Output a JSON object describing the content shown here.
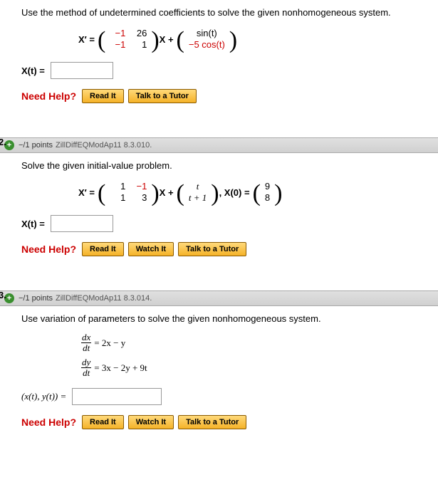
{
  "p1": {
    "prompt": "Use the method of undetermined coefficients to solve the given nonhomogeneous system.",
    "lhs": "X′ = ",
    "m": {
      "r1c1": "−1",
      "r1c2": "26",
      "r2c1": "−1",
      "r2c2": "1"
    },
    "mid": "X + ",
    "vec": {
      "top": "sin(t)",
      "bot": "−5 cos(t)"
    },
    "answer_label": "X(t) =",
    "help": "Need Help?",
    "read": "Read It",
    "tutor": "Talk to a Tutor"
  },
  "p2": {
    "qnum": "2.",
    "points": "−/1 points",
    "ref": "ZillDiffEQModAp11 8.3.010.",
    "prompt": "Solve the given initial-value problem.",
    "lhs": "X′ = ",
    "m": {
      "r1c1": "1",
      "r1c2": "−1",
      "r2c1": "1",
      "r2c2": "3"
    },
    "mid": "X + ",
    "vec": {
      "top": "t",
      "bot": "t + 1"
    },
    "comma": ",  X(0) = ",
    "ic": {
      "top": "9",
      "bot": "8"
    },
    "answer_label": "X(t) =",
    "help": "Need Help?",
    "read": "Read It",
    "watch": "Watch It",
    "tutor": "Talk to a Tutor"
  },
  "p3": {
    "qnum": "3.",
    "points": "−/1 points",
    "ref": "ZillDiffEQModAp11 8.3.014.",
    "prompt": "Use variation of parameters to solve the given nonhomogeneous system.",
    "eq1_l_num": "dx",
    "eq1_l_den": "dt",
    "eq1_r": " = 2x − y",
    "eq2_l_num": "dy",
    "eq2_l_den": "dt",
    "eq2_r": " = 3x − 2y + 9t",
    "answer_label": "(x(t), y(t))  =",
    "help": "Need Help?",
    "read": "Read It",
    "watch": "Watch It",
    "tutor": "Talk to a Tutor"
  }
}
